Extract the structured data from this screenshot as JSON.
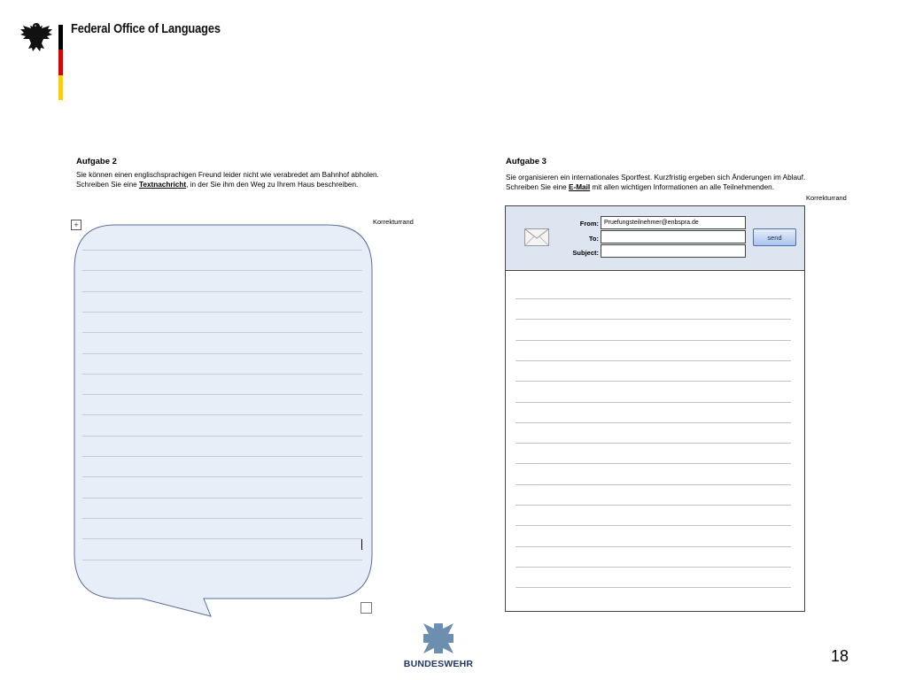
{
  "header": {
    "org_name": "Federal Office of Languages",
    "flag_colors": [
      "#000000",
      "#dd0000",
      "#ffce00"
    ],
    "emblem_icon": "federal-eagle-icon"
  },
  "task2": {
    "title": "Aufgabe 2",
    "text_before": "Sie können einen englischsprachigen Freund leider nicht wie verabredet am Bahnhof abholen. Schreiben Sie eine ",
    "text_emph": "Textnachricht",
    "text_after": ", in der Sie ihm den Weg zu Ihrem Haus beschreiben.",
    "margin_label": "Korrekturrand",
    "bubble_fill": "#e8eef8",
    "bubble_stroke": "#5a6f99"
  },
  "task3": {
    "title": "Aufgabe 3",
    "text_before": "Sie organisieren ein internationales Sportfest. Kurzfristig ergeben sich Änderungen im Ablauf. Schreiben Sie eine ",
    "text_emph": "E-Mail",
    "text_after": " mit allen wichtigen Informationen an alle Teilnehmenden.",
    "margin_label": "Korrekturrand",
    "email": {
      "from_label": "From:",
      "from_value": "Pruefungsteilnehmer@enbspra.de",
      "to_label": "To:",
      "to_value": "",
      "subject_label": "Subject:",
      "subject_value": "",
      "send_label": "send",
      "envelope_icon": "envelope-icon",
      "header_color": "#dde5f1"
    }
  },
  "footer": {
    "logo_text": "BUNDESWEHR",
    "logo_icon": "iron-cross-icon",
    "logo_color": "#6c8fb0",
    "page_number": "18"
  }
}
